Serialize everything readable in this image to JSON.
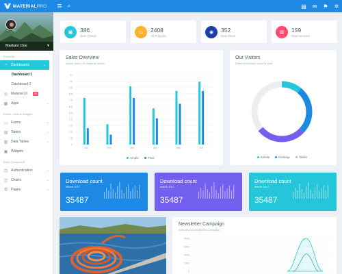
{
  "header": {
    "brand_bold": "MATERIAL",
    "brand_light": "PRO",
    "brand_color": "#1e88e5"
  },
  "sidebar": {
    "user_name": "Markarn Doe",
    "sections": {
      "personal": "Personal",
      "forms": "Forms, Table & Widgets",
      "extra": "Extra Component"
    },
    "items": {
      "dashboards": "Dashboards",
      "dashboard1": "Dashboard 1",
      "dashboard2": "Dashboard 2",
      "material_ui": "Material Ui",
      "material_ui_badge": "25",
      "apps": "Apps",
      "forms": "Forms",
      "tables": "Tables",
      "data_tables": "Data Tables",
      "widgets": "Widgets",
      "authentication": "Authentication",
      "charts": "Charts",
      "pages": "Pages"
    }
  },
  "stats": [
    {
      "value": "386",
      "label": "New Clients",
      "color": "#26c6da",
      "icon": "briefcase-icon"
    },
    {
      "value": "2408",
      "label": "All Projects",
      "color": "#ffb22b",
      "icon": "wallet-icon"
    },
    {
      "value": "352",
      "label": "New Items",
      "color": "#1e3fa8",
      "icon": "cart-icon"
    },
    {
      "value": "159",
      "label": "New Invoices",
      "color": "#fc4b6c",
      "icon": "chart-icon"
    }
  ],
  "sales": {
    "title": "Sales Overview",
    "subtitle": "Ample Admin Vs Material Admin"
  },
  "visitors": {
    "title": "Our Visitors",
    "subtitle": "Different Devices Used to Visit"
  },
  "downloads": [
    {
      "title": "Download count",
      "sub": "March 2017",
      "value": "35487",
      "color": "#1e88e5"
    },
    {
      "title": "Download count",
      "sub": "March 2017",
      "value": "35487",
      "color": "#7460ee"
    },
    {
      "title": "Download count",
      "sub": "March 2017",
      "value": "35487",
      "color": "#26c6da"
    }
  ],
  "newsletter": {
    "title": "Newsletter Campaign",
    "subtitle": "Overview of Newsletter Campaign"
  },
  "chart_data": [
    {
      "type": "bar",
      "categories": [
        "Jan",
        "Feb",
        "Mar",
        "Apr",
        "May",
        "Jun"
      ],
      "ylim": [
        0,
        12
      ],
      "yticks": [
        "0",
        "1.5",
        "2.5",
        "3.5",
        "4.5",
        "5.5",
        "6.5",
        "7.5",
        "8.5",
        "9.5",
        "10",
        "11"
      ],
      "series": [
        {
          "name": "Ample",
          "color": "#26c6da",
          "values": [
            8,
            3.5,
            10,
            6.2,
            9.2,
            10.8
          ]
        },
        {
          "name": "Pixel",
          "color": "#1e88e5",
          "values": [
            2.8,
            1.7,
            8,
            4.5,
            7,
            9.2
          ]
        }
      ]
    },
    {
      "type": "pie",
      "series": [
        {
          "name": "Mobile",
          "color": "#26c6da",
          "value": 11
        },
        {
          "name": "Desktop",
          "color": "#1e88e5",
          "value": 26
        },
        {
          "name": "Tablet",
          "color": "#7460ee",
          "value": 27
        },
        {
          "name": "Other",
          "color": "#eceff1",
          "value": 36
        }
      ],
      "legend": [
        "Mobile",
        "Desktop",
        "Tablet"
      ]
    },
    {
      "type": "area",
      "yticks": [
        "0",
        "2000",
        "4000",
        "6000",
        "8000"
      ]
    }
  ]
}
